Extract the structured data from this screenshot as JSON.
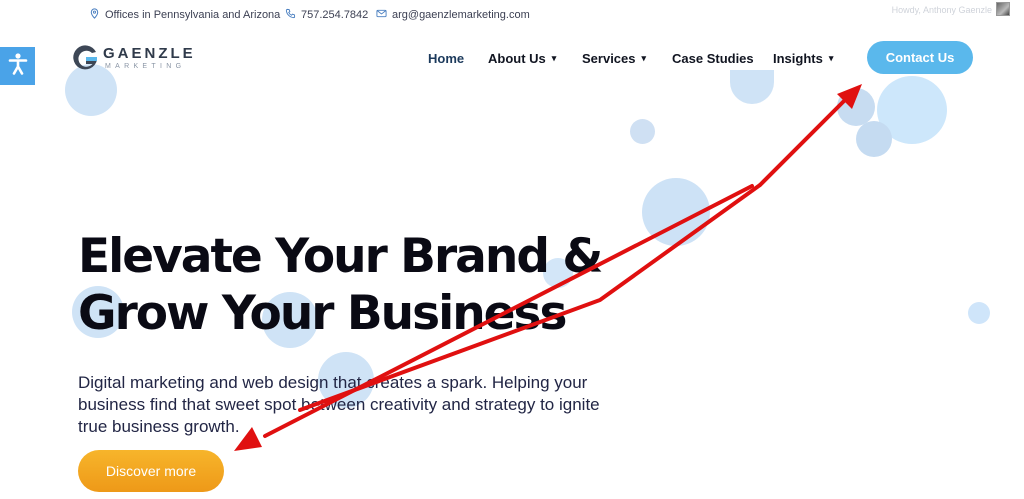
{
  "topbar": {
    "location": "Offices in Pennsylvania and Arizona",
    "phone": "757.254.7842",
    "email": "arg@gaenzlemarketing.com",
    "howdy": "Howdy, Anthony Gaenzle"
  },
  "logo": {
    "word": "GAENZLE",
    "sub": "MARKETING"
  },
  "nav": {
    "home": "Home",
    "about": "About Us",
    "services": "Services",
    "case_studies": "Case Studies",
    "insights": "Insights",
    "chevron": "▾",
    "contact": "Contact Us"
  },
  "hero": {
    "title_line1": "Elevate Your Brand &",
    "title_line2": "Grow Your Business",
    "subtitle": "Digital marketing and web design that creates a spark. Helping your business find that sweet spot between creativity and strategy to ignite true business growth.",
    "cta": "Discover more"
  },
  "colors": {
    "accent_blue": "#5ab8ec",
    "cta_orange": "#f2a622",
    "annotation_red": "#e01010",
    "bubble_blue": "#c9e2f7"
  },
  "icons": [
    "location-pin-icon",
    "phone-icon",
    "mail-icon",
    "accessibility-icon",
    "chevron-down-icon",
    "logo-g-icon"
  ]
}
